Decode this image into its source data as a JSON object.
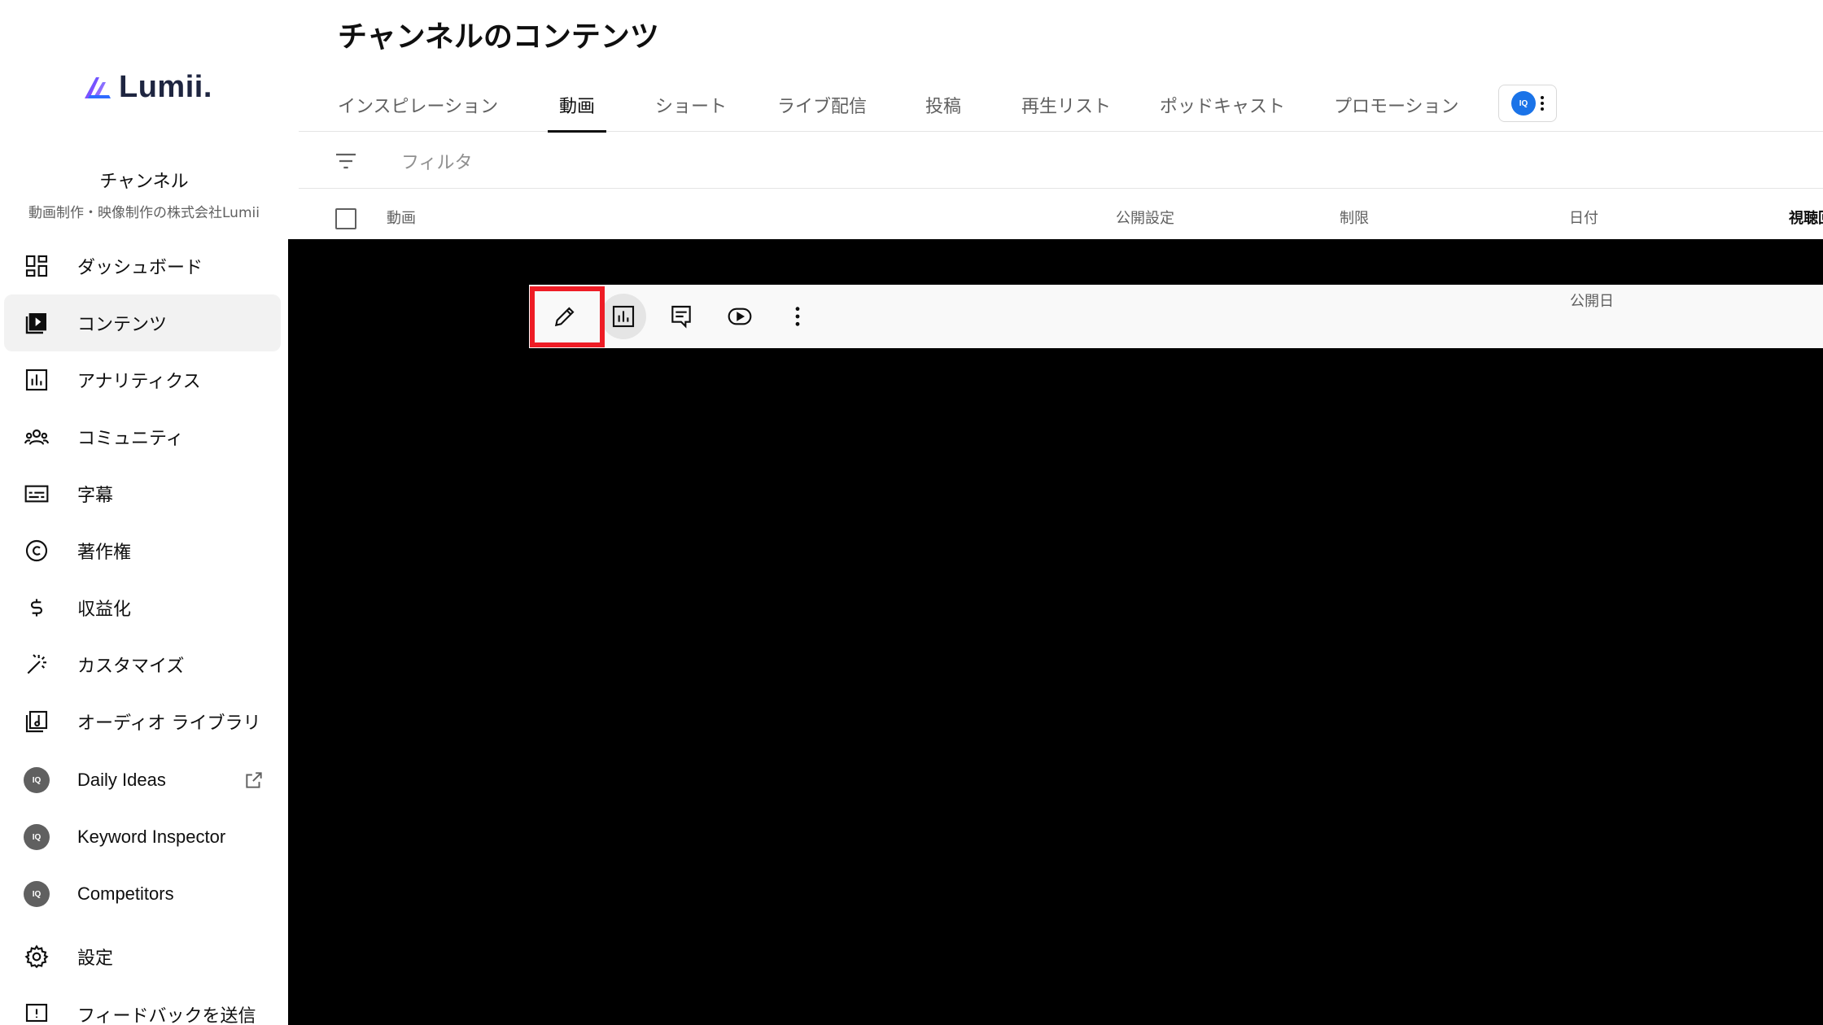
{
  "brand": {
    "name": "Lumii.",
    "accent_gradient": [
      "#2f6bff",
      "#c23bff"
    ]
  },
  "channel": {
    "title": "チャンネル",
    "subtitle": "動画制作・映像制作の株式会社Lumii"
  },
  "sidebar": {
    "items": [
      {
        "label": "ダッシュボード",
        "icon": "dashboard-icon",
        "active": false
      },
      {
        "label": "コンテンツ",
        "icon": "content-icon",
        "active": true
      },
      {
        "label": "アナリティクス",
        "icon": "analytics-icon",
        "active": false
      },
      {
        "label": "コミュニティ",
        "icon": "community-icon",
        "active": false
      },
      {
        "label": "字幕",
        "icon": "subtitles-icon",
        "active": false
      },
      {
        "label": "著作権",
        "icon": "copyright-icon",
        "active": false
      },
      {
        "label": "収益化",
        "icon": "dollar-icon",
        "active": false
      },
      {
        "label": "カスタマイズ",
        "icon": "magic-wand-icon",
        "active": false
      },
      {
        "label": "オーディオ ライブラリ",
        "icon": "audio-library-icon",
        "active": false
      },
      {
        "label": "Daily Ideas",
        "icon": "iq-badge-icon",
        "external": true
      },
      {
        "label": "Keyword Inspector",
        "icon": "iq-badge-icon"
      },
      {
        "label": "Competitors",
        "icon": "iq-badge-icon"
      },
      {
        "label": "設定",
        "icon": "gear-icon"
      },
      {
        "label": "フィードバックを送信",
        "icon": "feedback-icon"
      }
    ]
  },
  "page": {
    "title": "チャンネルのコンテンツ"
  },
  "tabs": [
    {
      "label": "インスピレーション",
      "active": false
    },
    {
      "label": "動画",
      "active": true
    },
    {
      "label": "ショート",
      "active": false
    },
    {
      "label": "ライブ配信",
      "active": false
    },
    {
      "label": "投稿",
      "active": false
    },
    {
      "label": "再生リスト",
      "active": false
    },
    {
      "label": "ポッドキャスト",
      "active": false
    },
    {
      "label": "プロモーション",
      "active": false
    }
  ],
  "extension_badge": "IQ",
  "filter": {
    "placeholder": "フィルタ"
  },
  "table": {
    "headers": {
      "video": "動画",
      "visibility": "公開設定",
      "restrictions": "制限",
      "date": "日付",
      "views": "視聴回"
    }
  },
  "row": {
    "date_label": "公開日"
  },
  "toolbar": {
    "actions": [
      "pencil-icon",
      "analytics-icon",
      "comments-icon",
      "youtube-play-icon",
      "kebab-icon"
    ]
  },
  "colors": {
    "highlight": "#ee1c25",
    "active_bg": "#f2f2f2",
    "overlay": "#000000"
  }
}
